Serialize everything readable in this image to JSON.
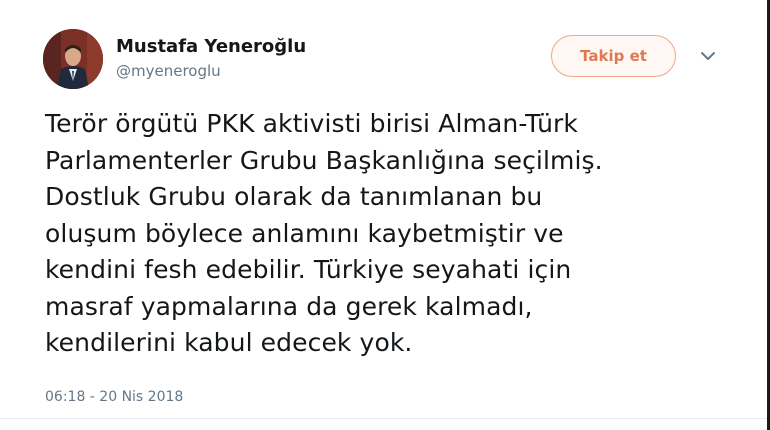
{
  "user": {
    "name": "Mustafa Yeneroğlu",
    "handle": "@myeneroglu"
  },
  "actions": {
    "follow_label": "Takip et"
  },
  "tweet": {
    "text": "Terör örgütü PKK aktivisti birisi Alman-Türk\nParlamenterler Grubu Başkanlığına seçilmiş.\nDostluk Grubu olarak da tanımlanan bu\noluşum böylece anlamını kaybetmiştir ve\nkendini fesh edebilir. Türkiye seyahati için\nmasraf yapmalarına da gerek kalmadı,\nkendilerini kabul edecek yok.",
    "timestamp": "06:18 - 20 Nis 2018"
  },
  "colors": {
    "follow_accent": "#e0794f",
    "secondary_text": "#657786"
  },
  "icons": {
    "menu": "chevron-down-icon",
    "avatar": "profile-photo"
  }
}
